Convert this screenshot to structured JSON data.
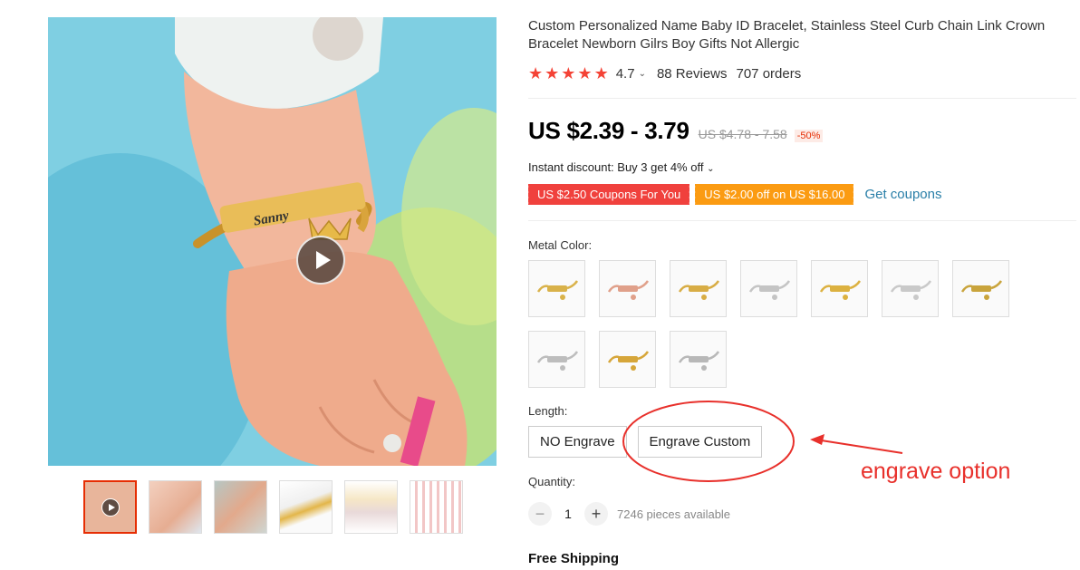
{
  "product": {
    "title": "Custom Personalized Name Baby ID Bracelet, Stainless Steel Curb Chain Link Crown Bracelet Newborn Gilrs Boy Gifts Not Allergic",
    "image_engraving": "Sanny"
  },
  "rating": {
    "stars_filled": 5,
    "value": "4.7",
    "reviews": "88 Reviews",
    "orders": "707 orders"
  },
  "price": {
    "current": "US $2.39 - 3.79",
    "original": "US $4.78 - 7.58",
    "discount": "-50%"
  },
  "promo": {
    "instant_discount": "Instant discount: Buy 3 get 4% off",
    "coupons": [
      "US $2.50 Coupons For You",
      "US $2.00 off on US $16.00"
    ],
    "get_coupons": "Get coupons"
  },
  "metal_color": {
    "label": "Metal Color:",
    "swatches": [
      {
        "name": "gold-crown",
        "color": "#d9b24a"
      },
      {
        "name": "rose-gold",
        "color": "#e0a08a"
      },
      {
        "name": "gold-bar",
        "color": "#d8ad45"
      },
      {
        "name": "silver-bar",
        "color": "#c4c4c4"
      },
      {
        "name": "gold-heart",
        "color": "#dcb140"
      },
      {
        "name": "silver-heart",
        "color": "#c9c9c9"
      },
      {
        "name": "gold-chain",
        "color": "#c9a43c"
      },
      {
        "name": "silver-clasp",
        "color": "#bdbdbd"
      },
      {
        "name": "gold-clasp",
        "color": "#d6a63a"
      },
      {
        "name": "silver-link",
        "color": "#b8b8b8"
      }
    ]
  },
  "length": {
    "label": "Length:",
    "options": [
      "NO Engrave",
      "Engrave Custom"
    ]
  },
  "annotation": {
    "text": "engrave option",
    "color": "#e8302b"
  },
  "quantity": {
    "label": "Quantity:",
    "value": "1",
    "available": "7246 pieces available"
  },
  "shipping": "Free Shipping"
}
